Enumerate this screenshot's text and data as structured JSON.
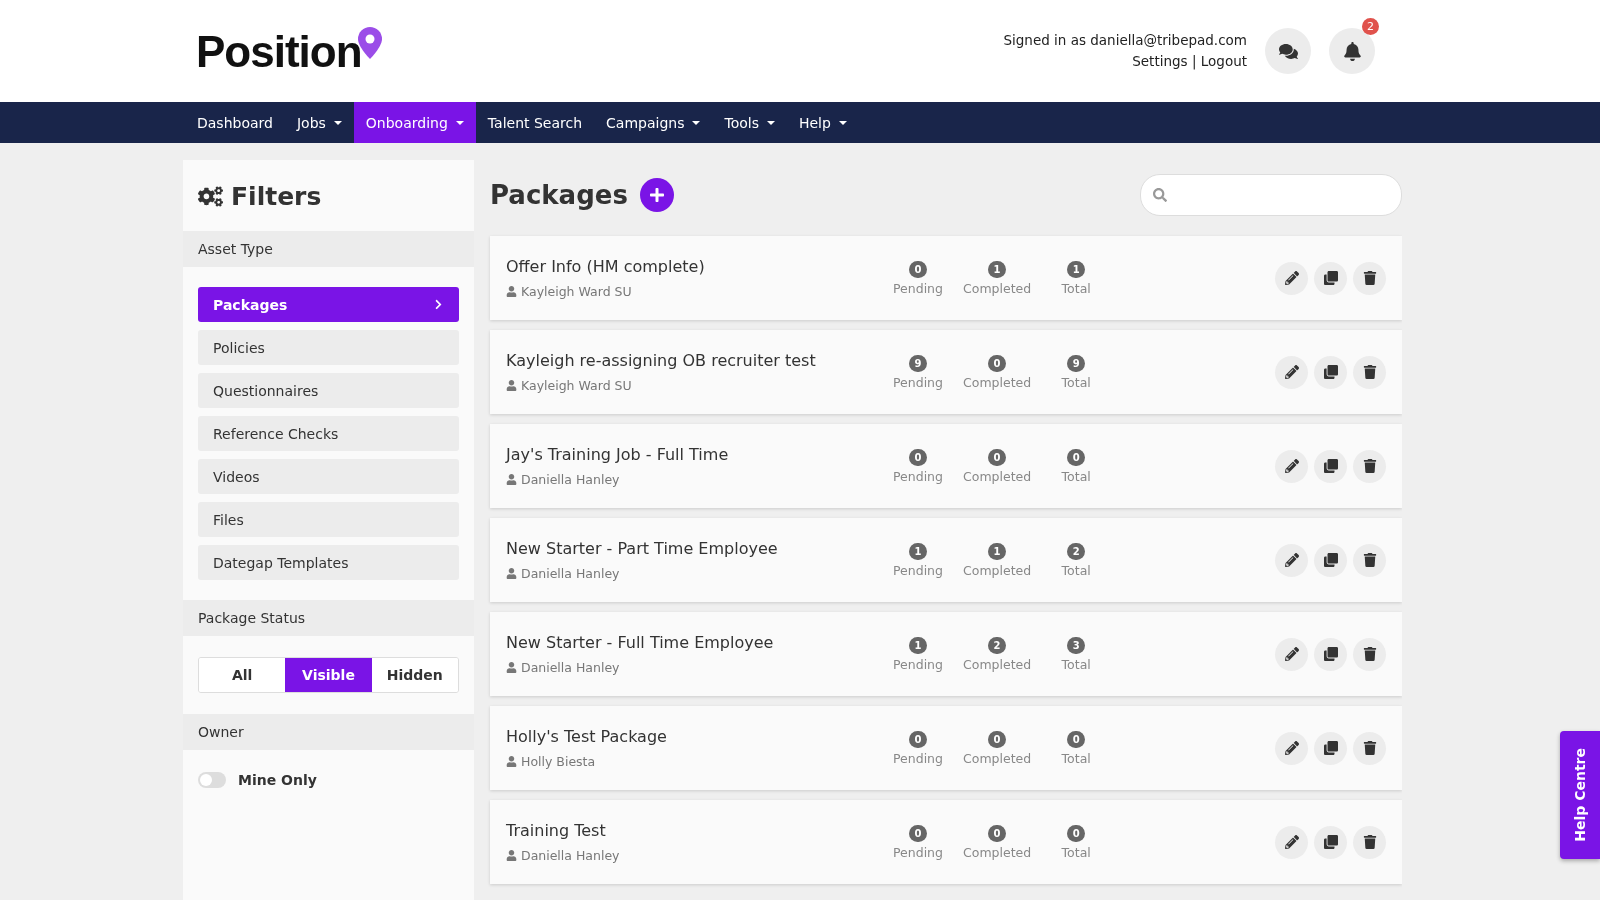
{
  "header": {
    "logo": "Position",
    "signed_in": "Signed in as daniella@tribepad.com",
    "links": [
      "Settings",
      "Logout"
    ],
    "link_separator": "|",
    "notification_count": "2"
  },
  "nav": [
    {
      "label": "Dashboard",
      "dropdown": false,
      "selected": false
    },
    {
      "label": "Jobs",
      "dropdown": true,
      "selected": false
    },
    {
      "label": "Onboarding",
      "dropdown": true,
      "selected": true
    },
    {
      "label": "Talent Search",
      "dropdown": false,
      "selected": false
    },
    {
      "label": "Campaigns",
      "dropdown": true,
      "selected": false
    },
    {
      "label": "Tools",
      "dropdown": true,
      "selected": false
    },
    {
      "label": "Help",
      "dropdown": true,
      "selected": false
    }
  ],
  "filters": {
    "title": "Filters",
    "asset_type": {
      "label": "Asset Type",
      "items": [
        {
          "label": "Packages",
          "selected": true
        },
        {
          "label": "Policies",
          "selected": false
        },
        {
          "label": "Questionnaires",
          "selected": false
        },
        {
          "label": "Reference Checks",
          "selected": false
        },
        {
          "label": "Videos",
          "selected": false
        },
        {
          "label": "Files",
          "selected": false
        },
        {
          "label": "Dategap Templates",
          "selected": false
        }
      ]
    },
    "package_status": {
      "label": "Package Status",
      "options": [
        {
          "label": "All",
          "selected": false
        },
        {
          "label": "Visible",
          "selected": true
        },
        {
          "label": "Hidden",
          "selected": false
        }
      ]
    },
    "owner": {
      "label": "Owner",
      "toggle": {
        "label": "Mine Only",
        "on": false
      }
    }
  },
  "packages": {
    "title": "Packages",
    "rows": [
      {
        "name": "Offer Info (HM complete)",
        "owner": "Kayleigh Ward SU",
        "stats": [
          {
            "count": "0",
            "label": "Pending"
          },
          {
            "count": "1",
            "label": "Completed"
          },
          {
            "count": "1",
            "label": "Total"
          }
        ]
      },
      {
        "name": "Kayleigh re-assigning OB recruiter test",
        "owner": "Kayleigh Ward SU",
        "stats": [
          {
            "count": "9",
            "label": "Pending"
          },
          {
            "count": "0",
            "label": "Completed"
          },
          {
            "count": "9",
            "label": "Total"
          }
        ]
      },
      {
        "name": "Jay's Training Job - Full Time",
        "owner": "Daniella Hanley",
        "stats": [
          {
            "count": "0",
            "label": "Pending"
          },
          {
            "count": "0",
            "label": "Completed"
          },
          {
            "count": "0",
            "label": "Total"
          }
        ]
      },
      {
        "name": "New Starter - Part Time Employee",
        "owner": "Daniella Hanley",
        "stats": [
          {
            "count": "1",
            "label": "Pending"
          },
          {
            "count": "1",
            "label": "Completed"
          },
          {
            "count": "2",
            "label": "Total"
          }
        ]
      },
      {
        "name": "New Starter - Full Time Employee",
        "owner": "Daniella Hanley",
        "stats": [
          {
            "count": "1",
            "label": "Pending"
          },
          {
            "count": "2",
            "label": "Completed"
          },
          {
            "count": "3",
            "label": "Total"
          }
        ]
      },
      {
        "name": "Holly's Test Package",
        "owner": "Holly Biesta",
        "stats": [
          {
            "count": "0",
            "label": "Pending"
          },
          {
            "count": "0",
            "label": "Completed"
          },
          {
            "count": "0",
            "label": "Total"
          }
        ]
      },
      {
        "name": "Training Test",
        "owner": "Daniella Hanley",
        "stats": [
          {
            "count": "0",
            "label": "Pending"
          },
          {
            "count": "0",
            "label": "Completed"
          },
          {
            "count": "0",
            "label": "Total"
          }
        ]
      }
    ]
  },
  "help_tab": "Help Centre"
}
